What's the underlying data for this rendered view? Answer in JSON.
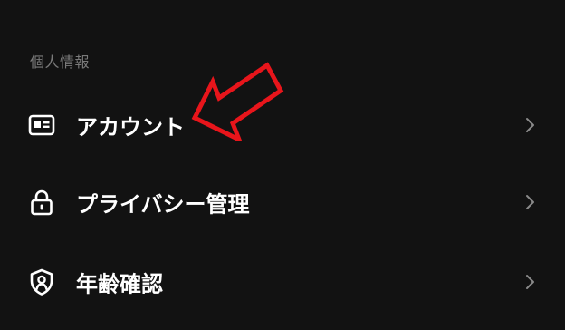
{
  "section": {
    "title": "個人情報"
  },
  "items": [
    {
      "label": "アカウント",
      "icon": "id-card-icon"
    },
    {
      "label": "プライバシー管理",
      "icon": "lock-icon"
    },
    {
      "label": "年齢確認",
      "icon": "shield-person-icon"
    }
  ],
  "colors": {
    "background": "#121212",
    "text": "#ffffff",
    "section_header": "#7a7a7a",
    "chevron": "#8a8a8a",
    "annotation_arrow": "#e8151b"
  }
}
